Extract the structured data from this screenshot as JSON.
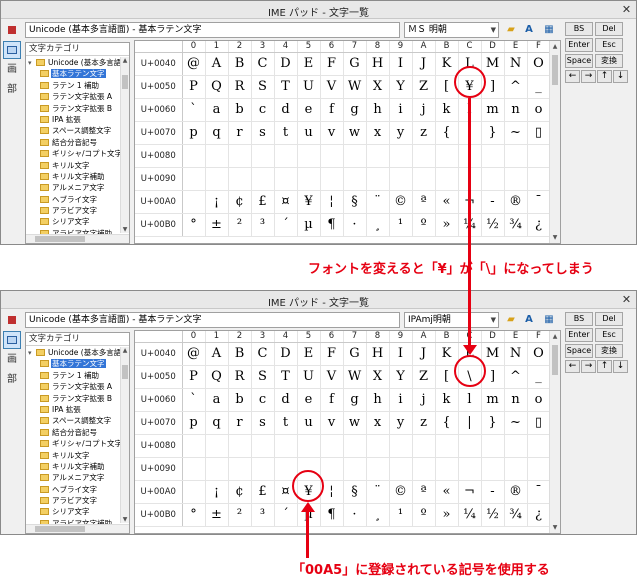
{
  "windows": [
    {
      "title": "IME パッド - 文字一覧",
      "path": "Unicode (基本多言語面) - 基本ラテン文字",
      "font_select": "ＭＳ 明朝"
    },
    {
      "title": "IME パッド - 文字一覧",
      "path": "Unicode (基本多言語面) - 基本ラテン文字",
      "font_select": "IPAmj明朝"
    }
  ],
  "left_toolbar": {
    "icons": [
      "handwriting-icon",
      "character-list-icon",
      "stroke-count-icon",
      "radical-icon"
    ],
    "labels": [
      "",
      "",
      "画",
      "部"
    ]
  },
  "tree": {
    "header": "文字カテゴリ",
    "root": "Unicode (基本多言語面)",
    "items": [
      "基本ラテン文字",
      "ラテン 1 補助",
      "ラテン文字拡張 A",
      "ラテン文字拡張 B",
      "IPA 拡張",
      "スペース調整文字",
      "結合分音記号",
      "ギリシャ/コプト文字",
      "キリル文字",
      "キリル文字補助",
      "アルメニア文字",
      "ヘブライ文字",
      "アラビア文字",
      "シリア文字",
      "アラビア文字補助",
      "ターナ文字"
    ],
    "selected_index": 0
  },
  "grid": {
    "columns": [
      "0",
      "1",
      "2",
      "3",
      "4",
      "5",
      "6",
      "7",
      "8",
      "9",
      "A",
      "B",
      "C",
      "D",
      "E",
      "F"
    ],
    "rows": [
      "U+0040",
      "U+0050",
      "U+0060",
      "U+0070",
      "U+0080",
      "U+0090",
      "U+00A0",
      "U+00B0"
    ],
    "cells_font1": [
      [
        "@",
        "A",
        "B",
        "C",
        "D",
        "E",
        "F",
        "G",
        "H",
        "I",
        "J",
        "K",
        "L",
        "M",
        "N",
        "O"
      ],
      [
        "P",
        "Q",
        "R",
        "S",
        "T",
        "U",
        "V",
        "W",
        "X",
        "Y",
        "Z",
        "[",
        "¥",
        "]",
        "^",
        "_"
      ],
      [
        "`",
        "a",
        "b",
        "c",
        "d",
        "e",
        "f",
        "g",
        "h",
        "i",
        "j",
        "k",
        "l",
        "m",
        "n",
        "o"
      ],
      [
        "p",
        "q",
        "r",
        "s",
        "t",
        "u",
        "v",
        "w",
        "x",
        "y",
        "z",
        "{",
        "|",
        "}",
        "~",
        "▯"
      ],
      [
        "",
        "",
        "",
        "",
        "",
        "",
        "",
        "",
        "",
        "",
        "",
        "",
        "",
        "",
        "",
        ""
      ],
      [
        "",
        "",
        "",
        "",
        "",
        "",
        "",
        "",
        "",
        "",
        "",
        "",
        "",
        "",
        "",
        ""
      ],
      [
        "",
        "¡",
        "¢",
        "£",
        "¤",
        "¥",
        "¦",
        "§",
        "¨",
        "©",
        "ª",
        "«",
        "¬",
        "-",
        "®",
        "¯"
      ],
      [
        "°",
        "±",
        "²",
        "³",
        "´",
        "µ",
        "¶",
        "·",
        "¸",
        "¹",
        "º",
        "»",
        "¼",
        "½",
        "¾",
        "¿"
      ]
    ],
    "cells_font2": [
      [
        "@",
        "A",
        "B",
        "C",
        "D",
        "E",
        "F",
        "G",
        "H",
        "I",
        "J",
        "K",
        "L",
        "M",
        "N",
        "O"
      ],
      [
        "P",
        "Q",
        "R",
        "S",
        "T",
        "U",
        "V",
        "W",
        "X",
        "Y",
        "Z",
        "[",
        "\\",
        "]",
        "^",
        "_"
      ],
      [
        "`",
        "a",
        "b",
        "c",
        "d",
        "e",
        "f",
        "g",
        "h",
        "i",
        "j",
        "k",
        "l",
        "m",
        "n",
        "o"
      ],
      [
        "p",
        "q",
        "r",
        "s",
        "t",
        "u",
        "v",
        "w",
        "x",
        "y",
        "z",
        "{",
        "|",
        "}",
        "~",
        "▯"
      ],
      [
        "",
        "",
        "",
        "",
        "",
        "",
        "",
        "",
        "",
        "",
        "",
        "",
        "",
        "",
        "",
        ""
      ],
      [
        "",
        "",
        "",
        "",
        "",
        "",
        "",
        "",
        "",
        "",
        "",
        "",
        "",
        "",
        "",
        ""
      ],
      [
        "",
        "¡",
        "¢",
        "£",
        "¤",
        "¥",
        "¦",
        "§",
        "¨",
        "©",
        "ª",
        "«",
        "¬",
        "-",
        "®",
        "¯"
      ],
      [
        "°",
        "±",
        "²",
        "³",
        "´",
        "µ",
        "¶",
        "·",
        "¸",
        "¹",
        "º",
        "»",
        "¼",
        "½",
        "¾",
        "¿"
      ]
    ]
  },
  "right_panel": {
    "bs": "BS",
    "del": "Del",
    "enter": "Enter",
    "esc": "Esc",
    "space": "Space",
    "convert": "変換",
    "arrows": [
      "←",
      "→",
      "↑",
      "↓"
    ]
  },
  "annotations": {
    "top": "フォントを変えると「¥」が「\\」になってしまう",
    "bottom": "「00A5」に登録されている記号を使用する",
    "color": "#e60012"
  }
}
